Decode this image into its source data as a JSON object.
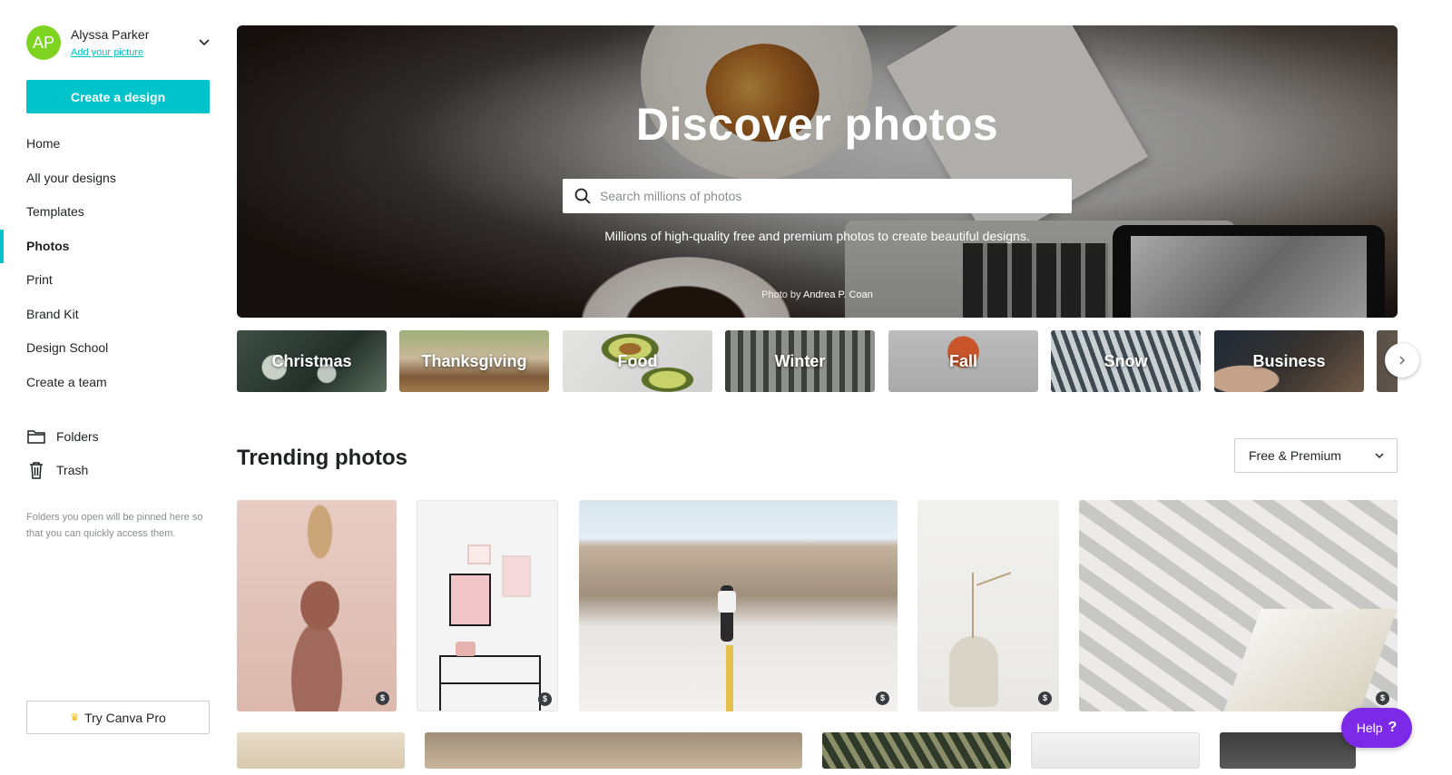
{
  "user": {
    "initials": "AP",
    "name": "Alyssa Parker",
    "add_picture": "Add your picture",
    "avatar_color": "#7ed321"
  },
  "sidebar": {
    "create_label": "Create a design",
    "nav": [
      "Home",
      "All your designs",
      "Templates",
      "Photos",
      "Print",
      "Brand Kit",
      "Design School",
      "Create a team"
    ],
    "active": "Photos",
    "folders_label": "Folders",
    "trash_label": "Trash",
    "hint": "Folders you open will be pinned here so that you can quickly access them.",
    "pro_label": "Try Canva Pro"
  },
  "hero": {
    "title": "Discover photos",
    "search_placeholder": "Search millions of photos",
    "subtitle": "Millions of high-quality free and premium photos to create beautiful designs.",
    "credit_prefix": "Photo by",
    "credit_name": "Andrea P. Coan"
  },
  "categories": [
    "Christmas",
    "Thanksgiving",
    "Food",
    "Winter",
    "Fall",
    "Snow",
    "Business"
  ],
  "trending": {
    "title": "Trending photos",
    "filter": "Free & Premium",
    "premium_badge": "$"
  },
  "help": {
    "label": "Help",
    "icon": "?"
  },
  "colors": {
    "accent": "#00c4cc",
    "help": "#7d2ae8",
    "text": "#1f2124",
    "muted": "#8a8d90"
  }
}
